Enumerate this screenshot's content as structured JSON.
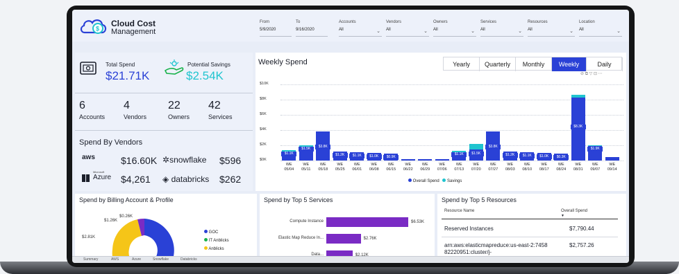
{
  "brand": {
    "line1": "Cloud Cost",
    "line2": "Management"
  },
  "filters": [
    {
      "label": "From",
      "value": "5/9/2020"
    },
    {
      "label": "To",
      "value": "9/16/2020"
    },
    {
      "label": "Accounts",
      "value": "All"
    },
    {
      "label": "Vendors",
      "value": "All"
    },
    {
      "label": "Owners",
      "value": "All"
    },
    {
      "label": "Services",
      "value": "All"
    },
    {
      "label": "Resources",
      "value": "All"
    },
    {
      "label": "Location",
      "value": "All"
    }
  ],
  "kpis": {
    "total_spend_label": "Total Spend",
    "total_spend_value": "$21.71K",
    "savings_label": "Potential Savings",
    "savings_value": "$2.54K"
  },
  "counts": [
    {
      "value": "6",
      "label": "Accounts"
    },
    {
      "value": "4",
      "label": "Vendors"
    },
    {
      "value": "22",
      "label": "Owners"
    },
    {
      "value": "42",
      "label": "Services"
    }
  ],
  "vendors": {
    "title": "Spend By Vendors",
    "items": [
      {
        "logo": "aws",
        "value": "$16.60K"
      },
      {
        "logo": "snowflake",
        "value": "$596"
      },
      {
        "logo": "Azure",
        "logo_small": "Microsoft",
        "value": "$4,261"
      },
      {
        "logo": "databricks",
        "value": "$262"
      }
    ]
  },
  "weekly": {
    "title": "Weekly Spend",
    "tabs": [
      "Yearly",
      "Quarterly",
      "Monthly",
      "Weekly",
      "Daily"
    ],
    "active_tab": "Weekly",
    "legend": [
      "Overall Spend",
      "Savings"
    ]
  },
  "chart_data": {
    "type": "bar",
    "title": "Weekly Spend",
    "ylim": [
      0,
      10
    ],
    "y_unit": "$K",
    "yticks": [
      "$0K",
      "$2K",
      "$4K",
      "$6K",
      "$8K",
      "$10K"
    ],
    "categories": [
      "WE 05/04",
      "WE 05/11",
      "WE 05/18",
      "WE 05/25",
      "WE 06/01",
      "WE 06/08",
      "WE 06/15",
      "WE 06/22",
      "WE 06/29",
      "WE 07/06",
      "WE 07/13",
      "WE 07/20",
      "WE 07/27",
      "WE 08/03",
      "WE 08/10",
      "WE 08/17",
      "WE 08/24",
      "WE 08/31",
      "WE 09/07",
      "WE 09/14"
    ],
    "series": [
      {
        "name": "Overall Spend",
        "values": [
          1.1,
          1.5,
          3.8,
          1.2,
          1.1,
          1.0,
          0.9,
          0.1,
          0.1,
          0.2,
          1.1,
          1.5,
          3.8,
          1.2,
          1.1,
          1.0,
          0.9,
          8.3,
          1.9,
          0.5
        ]
      },
      {
        "name": "Savings",
        "values": [
          0.3,
          0.5,
          0,
          0,
          0,
          0,
          0,
          0,
          0,
          0,
          0.2,
          0.7,
          0,
          0,
          0,
          0,
          0,
          0.3,
          0.1,
          0
        ]
      }
    ],
    "data_labels": [
      "$1.1K",
      "$1.5K",
      "$3.8K",
      "$1.2K",
      "$1.1K",
      "$1.0K",
      "$0.9K",
      "",
      "",
      "",
      "$1.1K",
      "$1.5K",
      "$3.8K",
      "$1.2K",
      "$1.1K",
      "$1.0K",
      "$0.3K",
      "$8.3K",
      "$1.9K",
      ""
    ]
  },
  "billing": {
    "title": "Spend by Billing Account & Profile",
    "labels": [
      "$1.26K",
      "$0.26K",
      "$2.81K"
    ],
    "legend": [
      "GOC",
      "IT Anblicks",
      "Anblicks"
    ],
    "colors": [
      "#2a41d6",
      "#18b24b",
      "#f5c518"
    ]
  },
  "services": {
    "title": "Spend by Top 5 Services",
    "items": [
      {
        "name": "Compute Instance",
        "value": "$6.53K",
        "fraction": 1.0
      },
      {
        "name": "Elastic Map Reduce In...",
        "value": "$2.76K",
        "fraction": 0.42
      },
      {
        "name": "Data...",
        "value": "$2.12K",
        "fraction": 0.32
      }
    ]
  },
  "resources": {
    "title": "Spend by Top 5 Resources",
    "col1": "Resource Name",
    "col2": "Overall Spend",
    "rows": [
      {
        "name": "Reserved Instances",
        "value": "$7,790.44"
      },
      {
        "name": "arn:aws:elasticmapreduce:us-east-2:745882220951:cluster/j-",
        "value": "$2,757.26"
      }
    ]
  },
  "page_tabs": [
    "Summary",
    "AWS",
    "Azure",
    "Snowflake",
    "Databricks"
  ]
}
